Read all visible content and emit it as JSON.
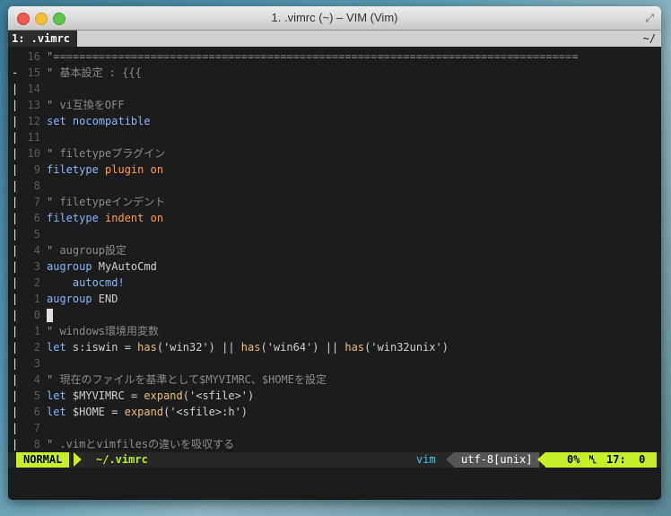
{
  "window": {
    "title": "1. .vimrc (~) – VIM (Vim)"
  },
  "tabline": {
    "tab_label": "1: .vimrc",
    "right": "~/"
  },
  "lines": [
    {
      "mark": " ",
      "num": "16",
      "parts": [
        {
          "t": "\"=================================================================================",
          "c": "c"
        }
      ]
    },
    {
      "mark": "-",
      "num": "15",
      "parts": [
        {
          "t": "\" 基本設定 : {{{",
          "c": "c"
        }
      ]
    },
    {
      "mark": "|",
      "num": "14",
      "parts": []
    },
    {
      "mark": "|",
      "num": "13",
      "parts": [
        {
          "t": "\" vi互換をOFF",
          "c": "c"
        }
      ]
    },
    {
      "mark": "|",
      "num": "12",
      "parts": [
        {
          "t": "set",
          "c": "k"
        },
        {
          "t": " nocompatible",
          "c": "k"
        }
      ]
    },
    {
      "mark": "|",
      "num": "11",
      "parts": []
    },
    {
      "mark": "|",
      "num": "10",
      "parts": [
        {
          "t": "\" filetypeプラグイン",
          "c": "c"
        }
      ]
    },
    {
      "mark": "|",
      "num": "9",
      "parts": [
        {
          "t": "filetype",
          "c": "k"
        },
        {
          "t": " plugin",
          "c": "o"
        },
        {
          "t": " on",
          "c": "o"
        }
      ]
    },
    {
      "mark": "|",
      "num": "8",
      "parts": []
    },
    {
      "mark": "|",
      "num": "7",
      "parts": [
        {
          "t": "\" filetypeインデント",
          "c": "c"
        }
      ]
    },
    {
      "mark": "|",
      "num": "6",
      "parts": [
        {
          "t": "filetype",
          "c": "k"
        },
        {
          "t": " indent",
          "c": "o"
        },
        {
          "t": " on",
          "c": "o"
        }
      ]
    },
    {
      "mark": "|",
      "num": "5",
      "parts": []
    },
    {
      "mark": "|",
      "num": "4",
      "parts": [
        {
          "t": "\" augroup設定",
          "c": "c"
        }
      ]
    },
    {
      "mark": "|",
      "num": "3",
      "parts": [
        {
          "t": "augroup",
          "c": "k"
        },
        {
          "t": " MyAutoCmd",
          "c": "p"
        }
      ]
    },
    {
      "mark": "|",
      "num": "2",
      "parts": [
        {
          "t": "    autocmd!",
          "c": "k"
        }
      ]
    },
    {
      "mark": "|",
      "num": "1",
      "parts": [
        {
          "t": "augroup",
          "c": "k"
        },
        {
          "t": " END",
          "c": "p"
        }
      ]
    },
    {
      "mark": "|",
      "num": "0",
      "cursor": true,
      "parts": []
    },
    {
      "mark": "|",
      "num": "1",
      "parts": [
        {
          "t": "\" windows環境用変数",
          "c": "c"
        }
      ]
    },
    {
      "mark": "|",
      "num": "2",
      "parts": [
        {
          "t": "let",
          "c": "k"
        },
        {
          "t": " s:iswin",
          "c": "p"
        },
        {
          "t": " = ",
          "c": "p"
        },
        {
          "t": "has",
          "c": "s"
        },
        {
          "t": "('win32') || ",
          "c": "p"
        },
        {
          "t": "has",
          "c": "s"
        },
        {
          "t": "('win64') || ",
          "c": "p"
        },
        {
          "t": "has",
          "c": "s"
        },
        {
          "t": "('win32unix')",
          "c": "p"
        }
      ]
    },
    {
      "mark": "|",
      "num": "3",
      "parts": []
    },
    {
      "mark": "|",
      "num": "4",
      "parts": [
        {
          "t": "\" 現在のファイルを基準として$MYVIMRC、$HOMEを設定",
          "c": "c"
        }
      ]
    },
    {
      "mark": "|",
      "num": "5",
      "parts": [
        {
          "t": "let",
          "c": "k"
        },
        {
          "t": " $MYVIMRC",
          "c": "p"
        },
        {
          "t": " = ",
          "c": "p"
        },
        {
          "t": "expand",
          "c": "s"
        },
        {
          "t": "('<sfile>')",
          "c": "p"
        }
      ]
    },
    {
      "mark": "|",
      "num": "6",
      "parts": [
        {
          "t": "let",
          "c": "k"
        },
        {
          "t": " $HOME",
          "c": "p"
        },
        {
          "t": " = ",
          "c": "p"
        },
        {
          "t": "expand",
          "c": "s"
        },
        {
          "t": "('<sfile>:h')",
          "c": "p"
        }
      ]
    },
    {
      "mark": "|",
      "num": "7",
      "parts": []
    },
    {
      "mark": "|",
      "num": "8",
      "parts": [
        {
          "t": "\" .vimとvimfilesの違いを吸収する",
          "c": "c"
        }
      ]
    }
  ],
  "statusline": {
    "mode": "NORMAL",
    "filename": "~/.vimrc",
    "filetype": "vim",
    "encoding": "utf-8[unix]",
    "percent": "0%",
    "line_icon": "LN",
    "linecol": "17:  0"
  },
  "colors": {
    "mode_bg": "#c8f02a",
    "filename": "#b5f02a",
    "filetype": "#35d0e8"
  }
}
